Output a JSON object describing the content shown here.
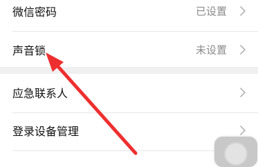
{
  "settings": {
    "rows": [
      {
        "label": "微信密码",
        "value": "已设置"
      },
      {
        "label": "声音锁",
        "value": "未设置"
      },
      {
        "label": "应急联系人",
        "value": ""
      },
      {
        "label": "登录设备管理",
        "value": ""
      }
    ]
  },
  "icons": {
    "chevron": "chevron-right-icon",
    "annotation": "red-arrow",
    "floating": "assistive-touch-button"
  },
  "colors": {
    "annotation_arrow": "#ee2f2f",
    "label_text": "#111111",
    "value_text": "#8a8a8a",
    "chevron": "#b5b5b5",
    "section_gap": "#f0f0f0",
    "divider": "#e6e6e6"
  }
}
